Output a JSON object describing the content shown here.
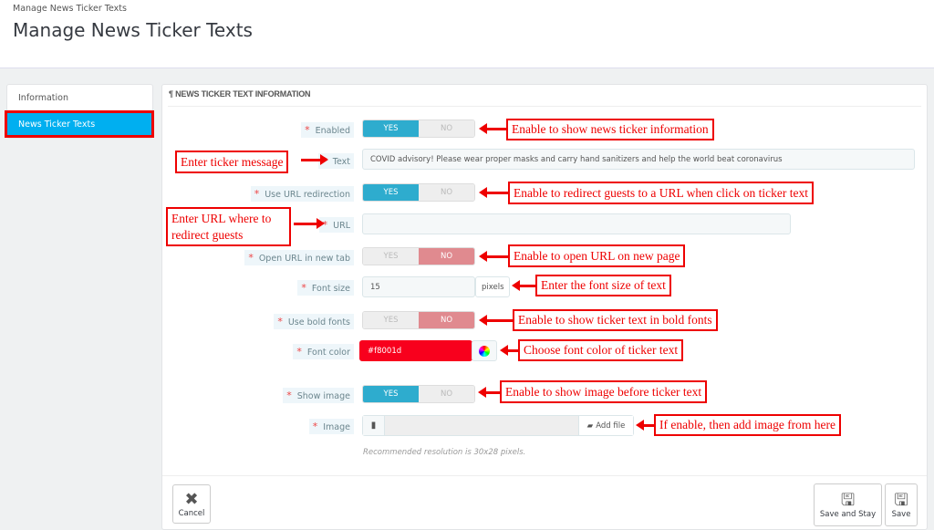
{
  "header": {
    "breadcrumb": "Manage News Ticker Texts",
    "title": "Manage News Ticker Texts"
  },
  "sidebar": {
    "items": [
      {
        "label": "Information",
        "active": false
      },
      {
        "label": "News Ticker Texts",
        "active": true
      }
    ]
  },
  "panel": {
    "heading": "¶ NEWS TICKER TEXT INFORMATION"
  },
  "form": {
    "required_mark": "*",
    "yes": "YES",
    "no": "NO",
    "enabled": {
      "label": "Enabled",
      "value": "YES"
    },
    "text": {
      "label": "Text",
      "value": "COVID advisory! Please wear proper masks and carry hand sanitizers and help the world beat coronavirus"
    },
    "use_url": {
      "label": "Use URL redirection",
      "value": "YES"
    },
    "url": {
      "label": "URL",
      "value": ""
    },
    "new_tab": {
      "label": "Open URL in new tab",
      "value": "NO"
    },
    "font_size": {
      "label": "Font size",
      "value": "15",
      "unit": "pixels"
    },
    "bold": {
      "label": "Use bold fonts",
      "value": "NO"
    },
    "font_color": {
      "label": "Font color",
      "value": "#f8001d"
    },
    "show_image": {
      "label": "Show image",
      "value": "YES"
    },
    "image": {
      "label": "Image",
      "add_file": "Add file",
      "help": "Recommended resolution is 30x28 pixels."
    }
  },
  "footer": {
    "cancel": "Cancel",
    "save_stay": "Save and Stay",
    "save": "Save"
  },
  "annotations": [
    "Enable to show news ticker information",
    "Enter ticker message",
    "Enable to redirect guests to a URL when click on ticker text",
    "Enter URL where to redirect guests",
    "Enable to open URL on new page",
    "Enter the font size of text",
    "Enable to show ticker text in bold fonts",
    "Choose font color of ticker text",
    "Enable to show image before ticker text",
    "If enable, then add image from here"
  ],
  "colors": {
    "accent": "#2eacce",
    "active_sidebar": "#00aff0",
    "annotation": "#ee0000",
    "no_active": "#e08a8f"
  }
}
